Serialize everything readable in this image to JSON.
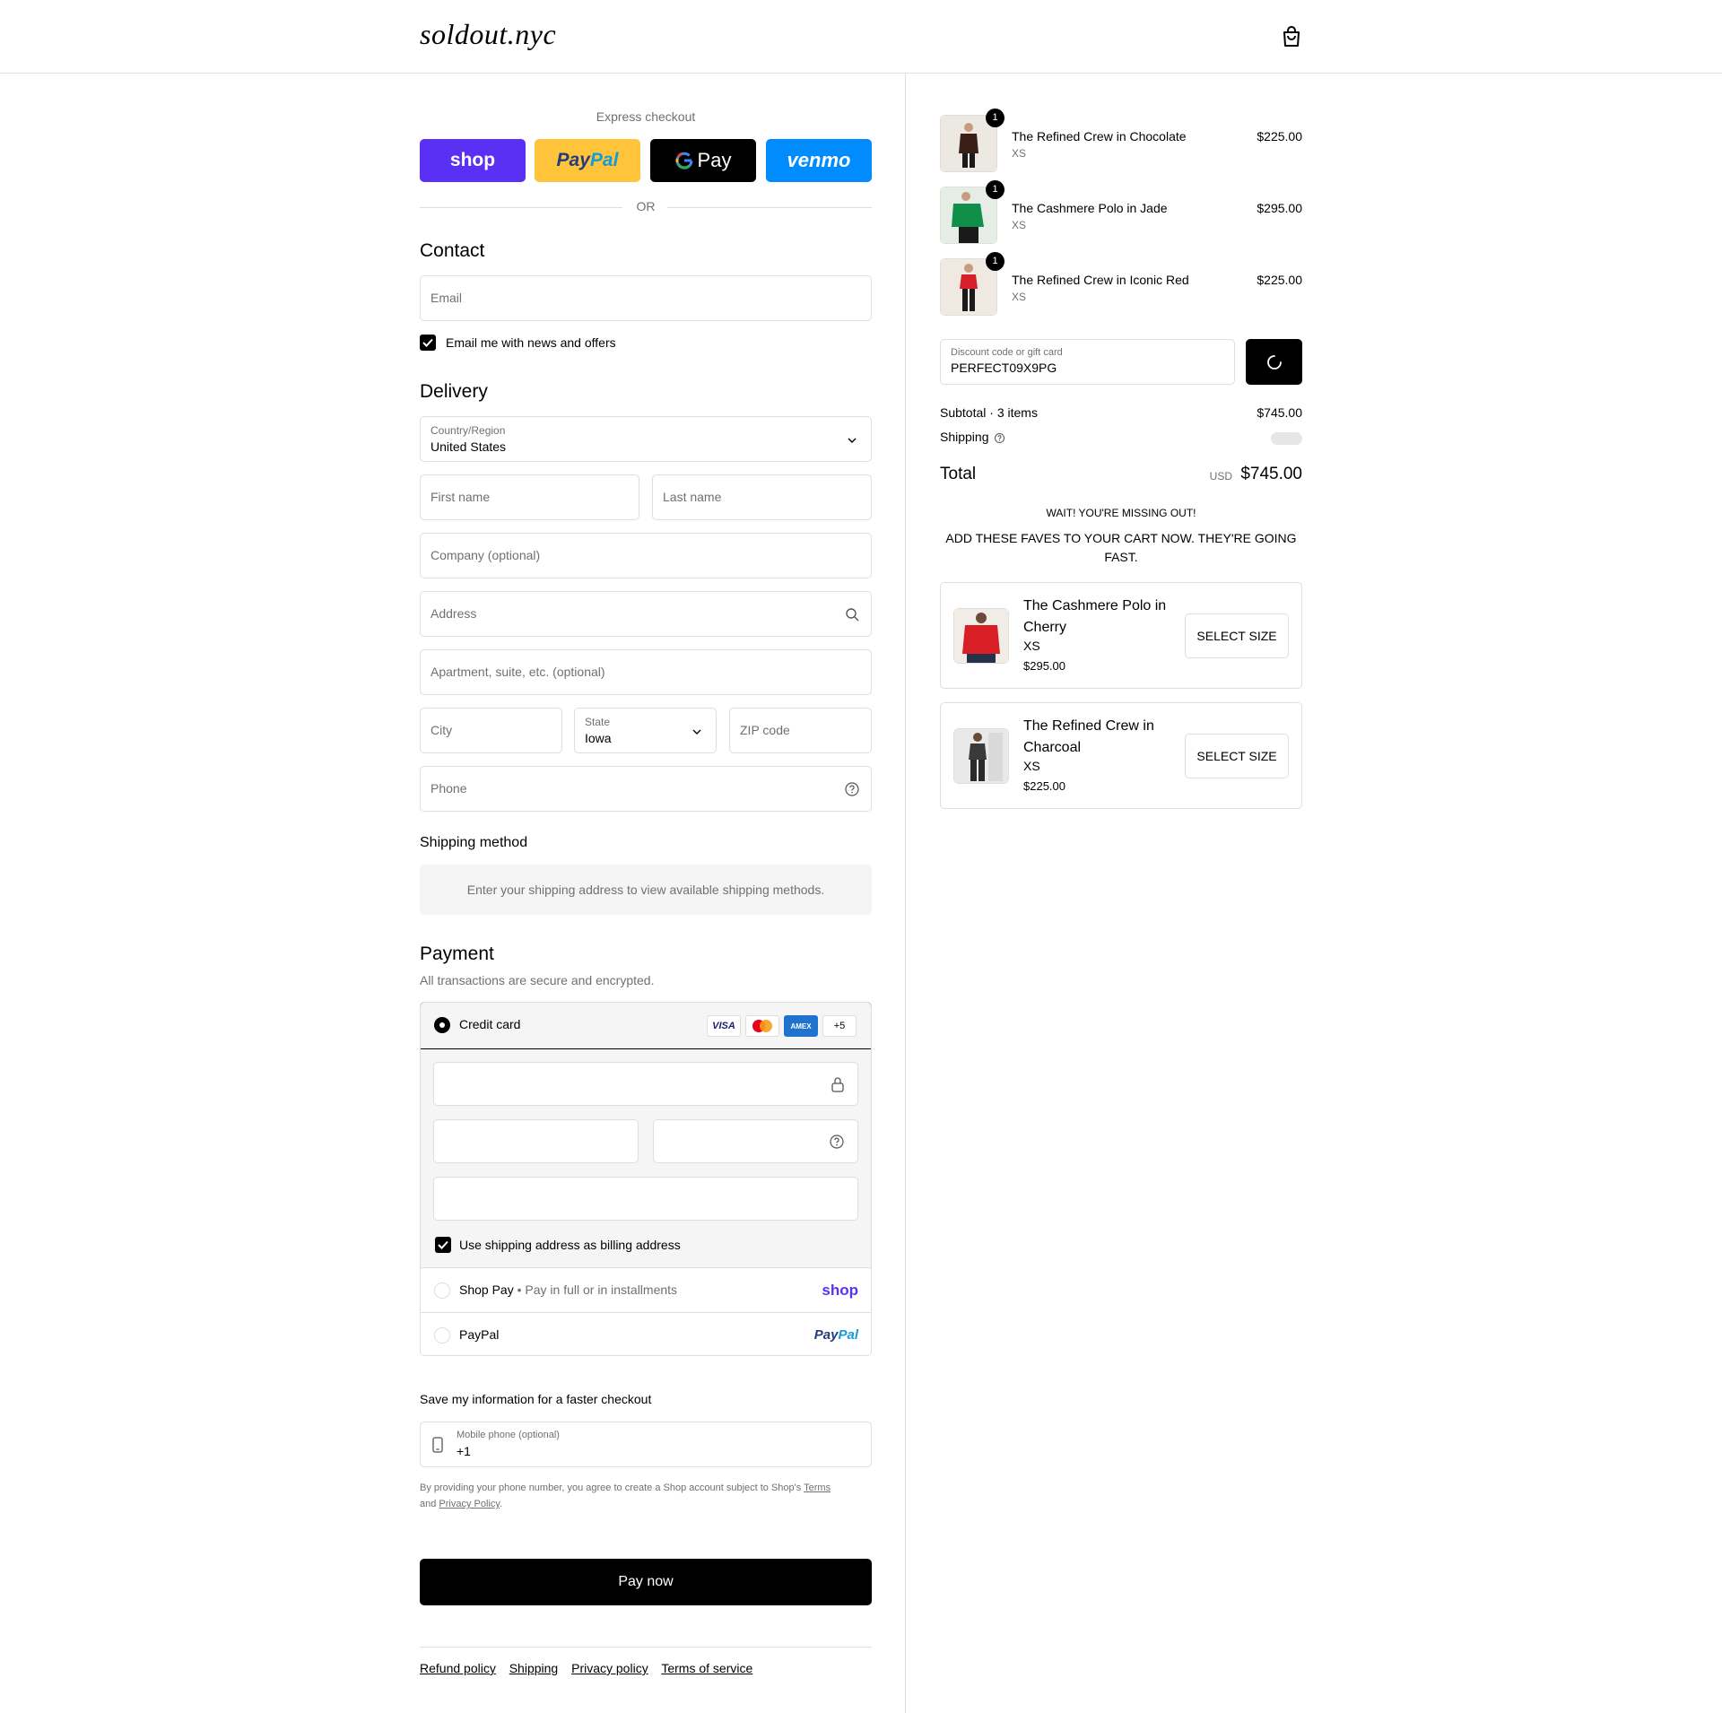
{
  "header": {
    "logo": "soldout.nyc",
    "cart_icon": "shopping-bag-icon"
  },
  "express": {
    "title": "Express checkout",
    "buttons": [
      {
        "label": "shop",
        "bg": "#5a31f4",
        "fg": "#ffffff"
      },
      {
        "label": "PayPal",
        "bg": "#ffc439",
        "fg": "#253b80"
      },
      {
        "label": "Pay",
        "bg": "#000000",
        "fg": "#ffffff"
      },
      {
        "label": "venmo",
        "bg": "#008cff",
        "fg": "#ffffff"
      }
    ],
    "or": "OR"
  },
  "contact": {
    "title": "Contact",
    "email_placeholder": "Email",
    "newsletter_label": "Email me with news and offers",
    "newsletter_checked": true
  },
  "delivery": {
    "title": "Delivery",
    "country_label": "Country/Region",
    "country_value": "United States",
    "first_name_placeholder": "First name",
    "last_name_placeholder": "Last name",
    "company_placeholder": "Company (optional)",
    "address_placeholder": "Address",
    "apartment_placeholder": "Apartment, suite, etc. (optional)",
    "city_placeholder": "City",
    "state_label": "State",
    "state_value": "Iowa",
    "zip_placeholder": "ZIP code",
    "phone_placeholder": "Phone"
  },
  "shipping_method": {
    "title": "Shipping method",
    "notice": "Enter your shipping address to view available shipping methods."
  },
  "payment": {
    "title": "Payment",
    "subtitle": "All transactions are secure and encrypted.",
    "credit_card_label": "Credit card",
    "card_badges": [
      "VISA",
      "",
      "AMEX",
      "+5"
    ],
    "billing_same_label": "Use shipping address as billing address",
    "shop_pay_label": "Shop Pay",
    "shop_pay_sub": "Pay in full or in installments",
    "shop_pay_logo": "shop",
    "paypal_label": "PayPal",
    "paypal_logo": "PayPal"
  },
  "save_info": {
    "title": "Save my information for a faster checkout",
    "phone_label": "Mobile phone (optional)",
    "phone_value": "+1",
    "legal_prefix": "By providing your phone number, you agree to create a Shop account subject to Shop's",
    "terms": "Terms",
    "and": "and",
    "privacy": "Privacy Policy",
    "period": "."
  },
  "pay_now": "Pay now",
  "footer_links": [
    "Refund policy",
    "Shipping",
    "Privacy policy",
    "Terms of service"
  ],
  "cart": {
    "items": [
      {
        "name": "The Refined Crew in Chocolate",
        "size": "XS",
        "price": "$225.00",
        "qty": "1",
        "color": "#3b1f17"
      },
      {
        "name": "The Cashmere Polo in Jade",
        "size": "XS",
        "price": "$295.00",
        "qty": "1",
        "color": "#0f8f4a"
      },
      {
        "name": "The Refined Crew in Iconic Red",
        "size": "XS",
        "price": "$225.00",
        "qty": "1",
        "color": "#d8202b"
      }
    ],
    "discount_label": "Discount code or gift card",
    "discount_value": "PERFECT09X9PG",
    "subtotal_label": "Subtotal · 3 items",
    "subtotal_value": "$745.00",
    "shipping_label": "Shipping",
    "total_label": "Total",
    "total_currency": "USD",
    "total_value": "$745.00"
  },
  "upsell": {
    "title": "WAIT! YOU'RE MISSING OUT!",
    "subtitle": "ADD THESE FAVES TO YOUR CART NOW. THEY'RE GOING FAST.",
    "items": [
      {
        "name": "The Cashmere Polo in Cherry",
        "size": "XS",
        "price": "$295.00",
        "button": "SELECT SIZE",
        "color": "#d81f26"
      },
      {
        "name": "The Refined Crew in Charcoal",
        "size": "XS",
        "price": "$225.00",
        "button": "SELECT SIZE",
        "color": "#3a3a3a"
      }
    ]
  }
}
